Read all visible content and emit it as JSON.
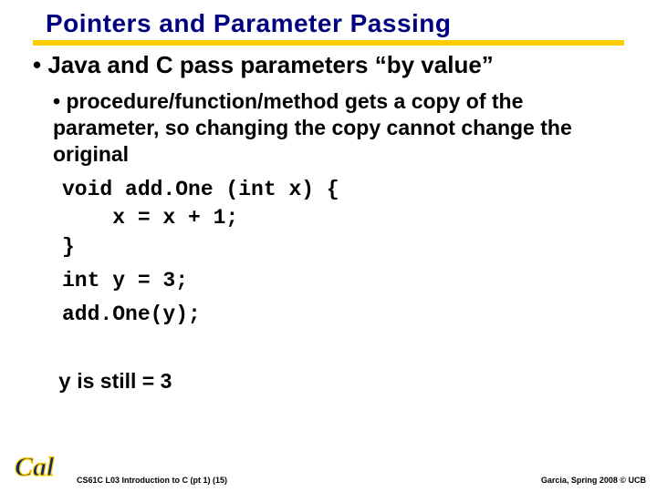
{
  "title": "Pointers and Parameter Passing",
  "bullet1": "• Java and C pass parameters “by value”",
  "bullet2": "• procedure/function/method gets a copy of the parameter, so changing the copy cannot change the original",
  "code_block1": "void add.One (int x) {\n    x = x + 1;\n}",
  "code_block2": "int y = 3;",
  "code_block3": "add.One(y);",
  "result_var": "y",
  "result_text": " is still = 3",
  "footer_left": "CS61C L03 Introduction to C (pt 1) (15)",
  "footer_right": "Garcia, Spring 2008 © UCB"
}
